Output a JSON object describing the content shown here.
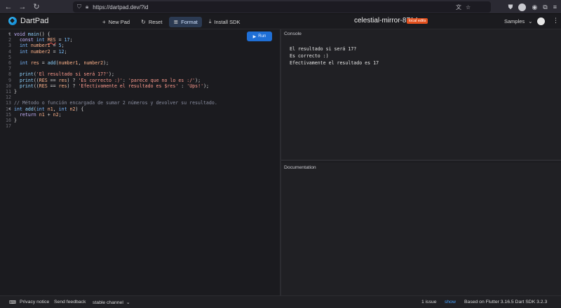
{
  "browser": {
    "url": "https://dartpad.dev/?id",
    "nav_back": "←",
    "nav_forward": "→",
    "nav_reload": "↻"
  },
  "header": {
    "app_name": "DartPad",
    "toolbar": {
      "new_pad": "New Pad",
      "reset": "Reset",
      "format": "Format",
      "install_sdk": "Install SDK"
    },
    "pad_title": "celestial-mirror-8714",
    "badge": "local edits",
    "samples": "Samples"
  },
  "editor": {
    "run_label": "Run",
    "line_numbers": [
      "1",
      "2",
      "3",
      "4",
      "5",
      "6",
      "7",
      "8",
      "9",
      "10",
      "11",
      "12",
      "13",
      "14",
      "15",
      "16",
      "17"
    ]
  },
  "console": {
    "title": "Console",
    "lines": [
      "El resultado si será 17?",
      "Es correcto :)",
      "Efectivamente el resultado es 17"
    ]
  },
  "docs": {
    "title": "Documentation"
  },
  "footer": {
    "privacy": "Privacy notice",
    "feedback": "Send feedback",
    "channel": "stable channel",
    "issues": "1 issue",
    "show": "show",
    "version": "Based on Flutter 3.16.5 Dart SDK 3.2.3"
  },
  "colors": {
    "run_button": "#1f6fd6",
    "badge": "#e4511e",
    "link": "#4aa3ff"
  }
}
